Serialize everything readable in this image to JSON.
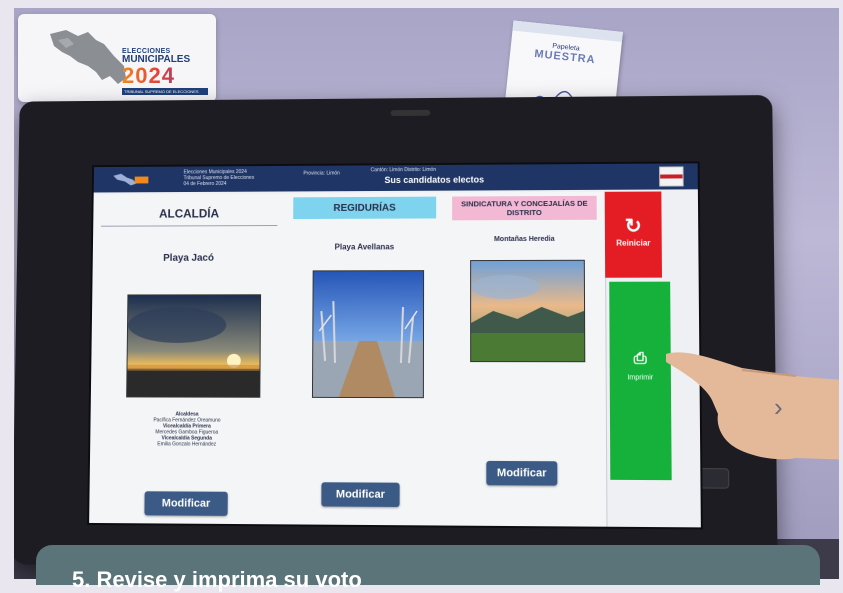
{
  "logo": {
    "line1": "ELECCIONES",
    "line2": "MUNICIPALES",
    "year": "2024",
    "org": "TRIBUNAL SUPREMO DE ELECCIONES"
  },
  "receipt": {
    "top": "Papeleta",
    "stamp": "MUESTRA"
  },
  "screen": {
    "header": {
      "info_line1": "Elecciones Municipales 2024",
      "info_line2": "Tribunal Supremo de Elecciones",
      "info_line3": "04 de Febrero 2024",
      "mid": "Provincia: Limón",
      "right": "Cantón: Limón       Distrito: Limón",
      "title": "Sus candidatos electos"
    },
    "columns": [
      {
        "heading": "ALCALDÍA",
        "place": "Playa Jacó",
        "candidates": [
          {
            "text": "Alcaldesa",
            "bold": true
          },
          {
            "text": "Pacífica Fernández Oreamuno",
            "bold": false
          },
          {
            "text": "Vicealcaldía Primera",
            "bold": true
          },
          {
            "text": "Mercedes Gamboa Figueroa",
            "bold": false
          },
          {
            "text": "Vicealcaldía Segunda",
            "bold": true
          },
          {
            "text": "Emilia Gonzalo Hernández",
            "bold": false
          }
        ],
        "button": "Modificar"
      },
      {
        "heading": "REGIDURÍAS",
        "place": "Playa Avellanas",
        "button": "Modificar"
      },
      {
        "heading": "SINDICATURA Y CONCEJALÍAS DE DISTRITO",
        "place": "Montañas Heredia",
        "button": "Modificar"
      }
    ],
    "reiniciar": {
      "icon": "refresh-icon",
      "label": "Reiniciar"
    },
    "imprimir": {
      "icon": "print-icon",
      "label": "Imprimir"
    }
  },
  "caption": {
    "text": "5. Revise y imprima su voto"
  },
  "colors": {
    "header": "#1e3566",
    "regidurias_head": "#7ed3ee",
    "sindicatura_head": "#f2b8d4",
    "reiniciar": "#e41d24",
    "imprimir": "#15b13a",
    "modificar": "#3c5a86",
    "caption": "#5a7479"
  }
}
